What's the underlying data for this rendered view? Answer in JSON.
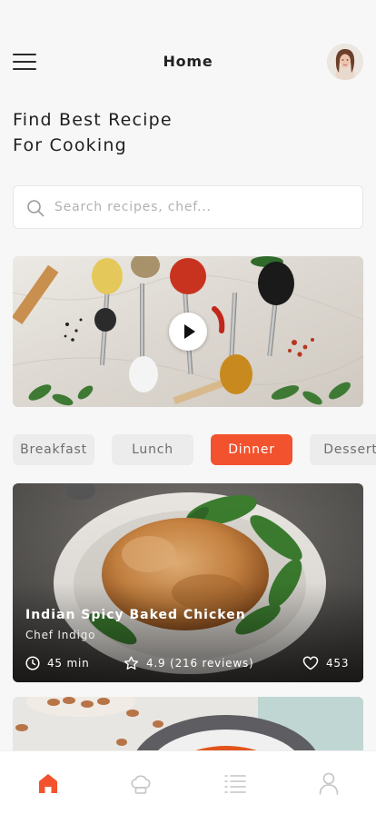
{
  "header": {
    "title": "Home",
    "menu_icon": "hamburger-menu-icon",
    "avatar": "user-avatar"
  },
  "headline": {
    "line1": "Find Best Recipe",
    "line2": "For Cooking"
  },
  "search": {
    "placeholder": "Search recipes, chef...",
    "value": "",
    "icon": "search-icon"
  },
  "video": {
    "image": "spices-on-spoons",
    "icon": "play-icon"
  },
  "categories": [
    {
      "label": "Breakfast",
      "active": false
    },
    {
      "label": "Lunch",
      "active": false
    },
    {
      "label": "Dinner",
      "active": true
    },
    {
      "label": "Dessert",
      "active": false
    }
  ],
  "featured": {
    "title": "Indian Spicy Baked Chicken",
    "author": "Chef Indigo",
    "time": "45 min",
    "rating": "4.9 (216 reviews)",
    "likes": "453"
  },
  "tabbar": {
    "items": [
      {
        "icon": "home-icon",
        "active": true
      },
      {
        "icon": "chef-hat-icon",
        "active": false
      },
      {
        "icon": "list-icon",
        "active": false
      },
      {
        "icon": "profile-icon",
        "active": false
      }
    ]
  },
  "colors": {
    "accent": "#f2522e",
    "background": "#f7f7f7",
    "chip": "#ececec",
    "inactive_icon": "#c4c4c4"
  }
}
